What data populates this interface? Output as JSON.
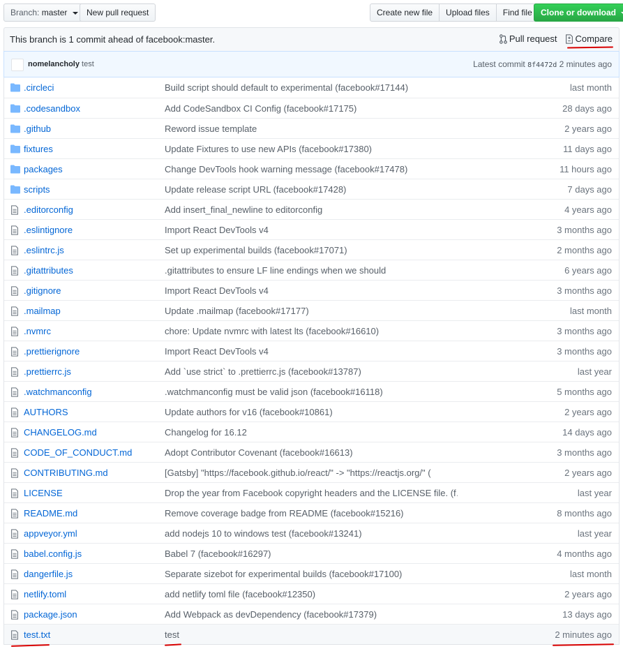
{
  "toolbar": {
    "branch_prefix": "Branch:",
    "branch_name": "master",
    "new_pr": "New pull request",
    "create_file": "Create new file",
    "upload_files": "Upload files",
    "find_file": "Find file",
    "clone": "Clone or download"
  },
  "ahead": {
    "text": "This branch is 1 commit ahead of facebook:master.",
    "pull_request": "Pull request",
    "compare": "Compare"
  },
  "commit": {
    "author": "nomelancholy",
    "message": "test",
    "latest_label": "Latest commit",
    "sha": "8f4472d",
    "time": "2 minutes ago"
  },
  "files": [
    {
      "type": "dir",
      "name": ".circleci",
      "msg": "Build script should default to experimental (facebook#17144)",
      "age": "last month"
    },
    {
      "type": "dir",
      "name": ".codesandbox",
      "msg": "Add CodeSandbox CI Config (facebook#17175)",
      "age": "28 days ago"
    },
    {
      "type": "dir",
      "name": ".github",
      "msg": "Reword issue template",
      "age": "2 years ago"
    },
    {
      "type": "dir",
      "name": "fixtures",
      "msg": "Update Fixtures to use new APIs (facebook#17380)",
      "age": "11 days ago"
    },
    {
      "type": "dir",
      "name": "packages",
      "msg": "Change DevTools hook warning message (facebook#17478)",
      "age": "11 hours ago"
    },
    {
      "type": "dir",
      "name": "scripts",
      "msg": "Update release script URL (facebook#17428)",
      "age": "7 days ago"
    },
    {
      "type": "file",
      "name": ".editorconfig",
      "msg": "Add insert_final_newline to editorconfig",
      "age": "4 years ago"
    },
    {
      "type": "file",
      "name": ".eslintignore",
      "msg": "Import React DevTools v4",
      "age": "3 months ago"
    },
    {
      "type": "file",
      "name": ".eslintrc.js",
      "msg": "Set up experimental builds (facebook#17071)",
      "age": "2 months ago"
    },
    {
      "type": "file",
      "name": ".gitattributes",
      "msg": ".gitattributes to ensure LF line endings when we should",
      "age": "6 years ago"
    },
    {
      "type": "file",
      "name": ".gitignore",
      "msg": "Import React DevTools v4",
      "age": "3 months ago"
    },
    {
      "type": "file",
      "name": ".mailmap",
      "msg": "Update .mailmap (facebook#17177)",
      "age": "last month"
    },
    {
      "type": "file",
      "name": ".nvmrc",
      "msg": "chore: Update nvmrc with latest lts (facebook#16610)",
      "age": "3 months ago"
    },
    {
      "type": "file",
      "name": ".prettierignore",
      "msg": "Import React DevTools v4",
      "age": "3 months ago"
    },
    {
      "type": "file",
      "name": ".prettierrc.js",
      "msg": "Add `use strict` to .prettierrc.js (facebook#13787)",
      "age": "last year"
    },
    {
      "type": "file",
      "name": ".watchmanconfig",
      "msg": ".watchmanconfig must be valid json (facebook#16118)",
      "age": "5 months ago"
    },
    {
      "type": "file",
      "name": "AUTHORS",
      "msg": "Update authors for v16 (facebook#10861)",
      "age": "2 years ago"
    },
    {
      "type": "file",
      "name": "CHANGELOG.md",
      "msg": "Changelog for 16.12",
      "age": "14 days ago"
    },
    {
      "type": "file",
      "name": "CODE_OF_CONDUCT.md",
      "msg": "Adopt Contributor Covenant (facebook#16613)",
      "age": "3 months ago"
    },
    {
      "type": "file",
      "name": "CONTRIBUTING.md",
      "msg": "[Gatsby] \"https://facebook.github.io/react/\" -> \"https://reactjs.org/\" (",
      "age": "2 years ago"
    },
    {
      "type": "file",
      "name": "LICENSE",
      "msg": "Drop the year from Facebook copyright headers and the LICENSE file. (f…",
      "age": "last year"
    },
    {
      "type": "file",
      "name": "README.md",
      "msg": "Remove coverage badge from README (facebook#15216)",
      "age": "8 months ago"
    },
    {
      "type": "file",
      "name": "appveyor.yml",
      "msg": "add nodejs 10 to windows test (facebook#13241)",
      "age": "last year"
    },
    {
      "type": "file",
      "name": "babel.config.js",
      "msg": "Babel 7 (facebook#16297)",
      "age": "4 months ago"
    },
    {
      "type": "file",
      "name": "dangerfile.js",
      "msg": "Separate sizebot for experimental builds (facebook#17100)",
      "age": "last month"
    },
    {
      "type": "file",
      "name": "netlify.toml",
      "msg": "add netlify toml file (facebook#12350)",
      "age": "2 years ago"
    },
    {
      "type": "file",
      "name": "package.json",
      "msg": "Add Webpack as devDependency (facebook#17379)",
      "age": "13 days ago"
    },
    {
      "type": "file",
      "name": "test.txt",
      "msg": "test",
      "age": "2 minutes ago",
      "highlight": true
    }
  ],
  "icons": {
    "dir": "folder-icon",
    "file": "file-icon"
  },
  "colors": {
    "link": "#0366d6",
    "folder": "#79b8ff",
    "annotation": "#d80000",
    "green": "#28a745"
  }
}
